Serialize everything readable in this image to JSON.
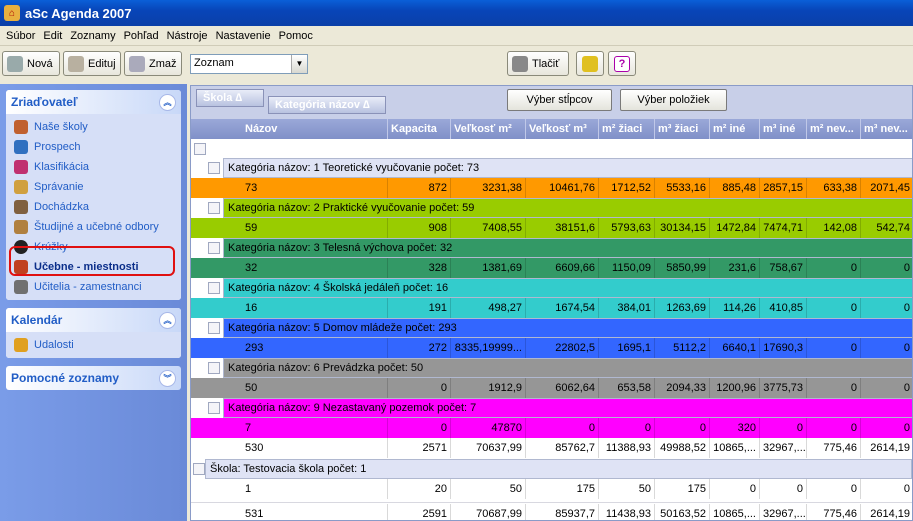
{
  "app": {
    "title": "aSc Agenda 2007"
  },
  "menu": [
    "Súbor",
    "Edit",
    "Zoznamy",
    "Pohľad",
    "Nástroje",
    "Nastavenie",
    "Pomoc"
  ],
  "toolbar": {
    "new_label": "Nová",
    "edit_label": "Edituj",
    "delete_label": "Zmaž",
    "view_value": "Zoznam",
    "print_label": "Tlačiť"
  },
  "sidebar": {
    "zriad_title": "Zriaďovateľ",
    "zriad_items": [
      "Naše školy",
      "Prospech",
      "Klasifikácia",
      "Správanie",
      "Dochádzka",
      "Študijné a učebné odbory",
      "Krúžky",
      "Učebne - miestnosti",
      "Učitelia - zamestnanci"
    ],
    "kal_title": "Kalendár",
    "kal_items": [
      "Udalosti"
    ],
    "pom_title": "Pomocné zoznamy"
  },
  "grid": {
    "group_chip1": "Škola  ∆",
    "group_chip2": "Kategória názov  ∆",
    "btn_cols": "Výber stĺpcov",
    "btn_items": "Výber položiek",
    "headers": [
      "Názov",
      "Kapacita",
      "Veľkosť m²",
      "Veľkosť m³",
      "m² žiaci",
      "m³ žiaci",
      "m² iné",
      "m³ iné",
      "m² nev...",
      "m³ nev..."
    ],
    "categories": [
      {
        "label": "Kategória názov:  1 Teoretické vyučovanie  počet: 73",
        "values": [
          "73",
          "872",
          "3231,38",
          "10461,76",
          "1712,52",
          "5533,16",
          "885,48",
          "2857,15",
          "633,38",
          "2071,45"
        ],
        "color": "#ff9900",
        "catbg": "#dfe3f5"
      },
      {
        "label": "Kategória názov:  2 Praktické vyučovanie  počet: 59",
        "values": [
          "59",
          "908",
          "7408,55",
          "38151,6",
          "5793,63",
          "30134,15",
          "1472,84",
          "7474,71",
          "142,08",
          "542,74"
        ],
        "color": "#99cc00",
        "catbg": "#99cc00"
      },
      {
        "label": "Kategória názov:  3 Telesná výchova  počet: 32",
        "values": [
          "32",
          "328",
          "1381,69",
          "6609,66",
          "1150,09",
          "5850,99",
          "231,6",
          "758,67",
          "0",
          "0"
        ],
        "color": "#339966",
        "catbg": "#339966"
      },
      {
        "label": "Kategória názov:  4 Školská jedáleň  počet: 16",
        "values": [
          "16",
          "191",
          "498,27",
          "1674,54",
          "384,01",
          "1263,69",
          "114,26",
          "410,85",
          "0",
          "0"
        ],
        "color": "#33cccc",
        "catbg": "#33cccc"
      },
      {
        "label": "Kategória názov:  5 Domov mládeže  počet: 293",
        "values": [
          "293",
          "272",
          "8335,19999...",
          "22802,5",
          "1695,1",
          "5112,2",
          "6640,1",
          "17690,3",
          "0",
          "0"
        ],
        "color": "#3366ff",
        "catbg": "#3366ff"
      },
      {
        "label": "Kategória názov:  6 Prevádzka  počet: 50",
        "values": [
          "50",
          "0",
          "1912,9",
          "6062,64",
          "653,58",
          "2094,33",
          "1200,96",
          "3775,73",
          "0",
          "0"
        ],
        "color": "#969696",
        "catbg": "#969696"
      },
      {
        "label": "Kategória názov:  9 Nezastavaný pozemok  počet: 7",
        "values": [
          "7",
          "0",
          "47870",
          "0",
          "0",
          "0",
          "320",
          "0",
          "0",
          "0"
        ],
        "color": "#ff00ff",
        "catbg": "#ff00ff"
      }
    ],
    "school1_total": [
      "530",
      "2571",
      "70637,99",
      "85762,7",
      "11388,93",
      "49988,52",
      "10865,...",
      "32967,...",
      "775,46",
      "2614,19"
    ],
    "school2_label": "Škola:  Testovacia škola  počet: 1",
    "school2_row": [
      "1",
      "20",
      "50",
      "175",
      "50",
      "175",
      "0",
      "0",
      "0",
      "0"
    ],
    "grand_total": [
      "531",
      "2591",
      "70687,99",
      "85937,7",
      "11438,93",
      "50163,52",
      "10865,...",
      "32967,...",
      "775,46",
      "2614,19"
    ]
  }
}
